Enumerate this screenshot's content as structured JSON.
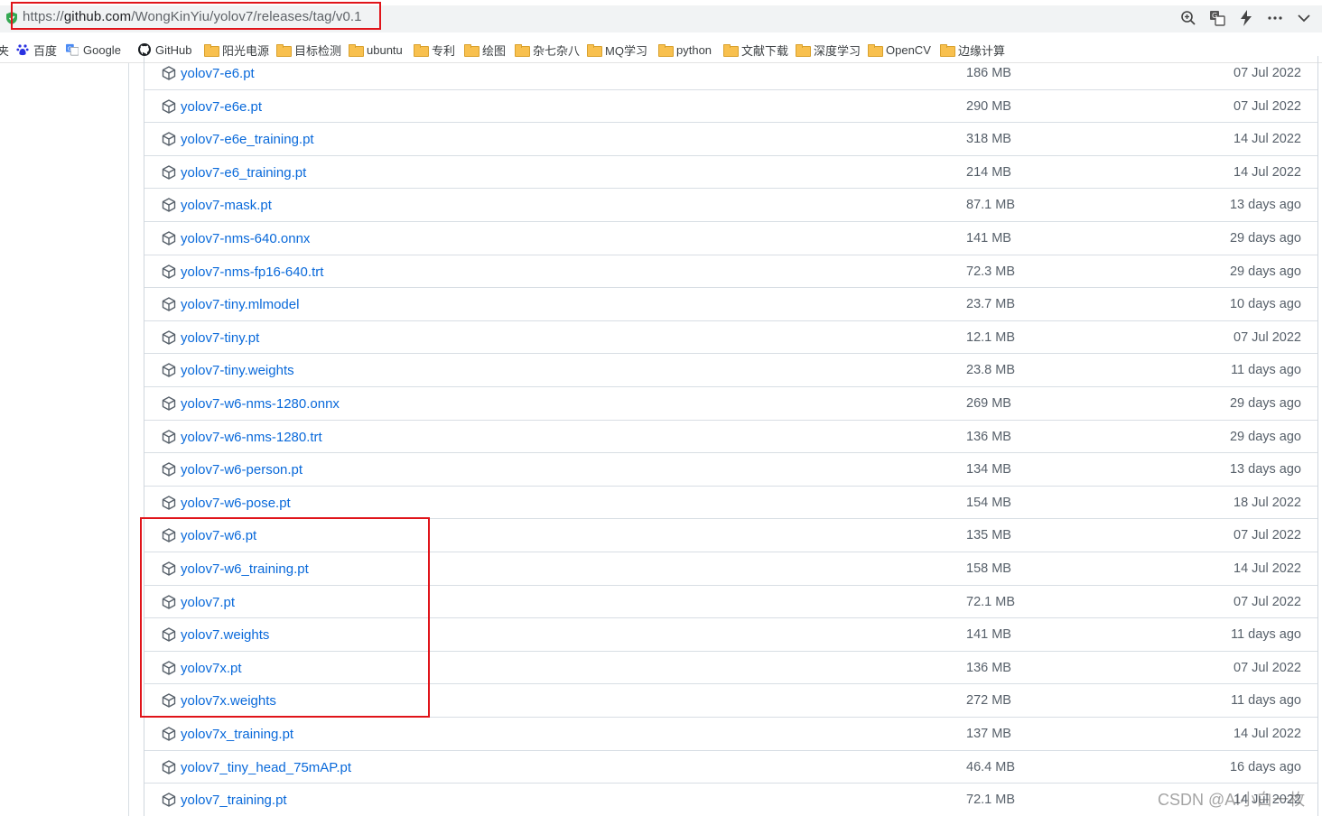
{
  "address_bar": {
    "url_scheme": "https://",
    "url_host": "github.com",
    "url_path": "/WongKinYiu/yolov7/releases/tag/v0.1",
    "actions": [
      "zoom-icon",
      "translate-icon",
      "lightning-icon",
      "more-icon",
      "chevron-down-icon"
    ]
  },
  "bookmarks": [
    {
      "label": "夹",
      "icon": "bookmark-folder-icon"
    },
    {
      "label": "百度",
      "icon": "baidu-icon"
    },
    {
      "label": "Google",
      "icon": "google-icon"
    },
    {
      "label": "GitHub",
      "icon": "github-icon"
    },
    {
      "label": "阳光电源",
      "icon": "folder-icon"
    },
    {
      "label": "目标检测",
      "icon": "folder-icon"
    },
    {
      "label": "ubuntu",
      "icon": "folder-icon"
    },
    {
      "label": "专利",
      "icon": "folder-icon"
    },
    {
      "label": "绘图",
      "icon": "folder-icon"
    },
    {
      "label": "杂七杂八",
      "icon": "folder-icon"
    },
    {
      "label": "MQ学习",
      "icon": "folder-icon"
    },
    {
      "label": "python",
      "icon": "folder-icon"
    },
    {
      "label": "文献下载",
      "icon": "folder-icon"
    },
    {
      "label": "深度学习",
      "icon": "folder-icon"
    },
    {
      "label": "OpenCV",
      "icon": "folder-icon"
    },
    {
      "label": "边缘计算",
      "icon": "folder-icon"
    }
  ],
  "assets": [
    {
      "name": "yolov7-e6.pt",
      "size": "186 MB",
      "date": "07 Jul 2022"
    },
    {
      "name": "yolov7-e6e.pt",
      "size": "290 MB",
      "date": "07 Jul 2022"
    },
    {
      "name": "yolov7-e6e_training.pt",
      "size": "318 MB",
      "date": "14 Jul 2022"
    },
    {
      "name": "yolov7-e6_training.pt",
      "size": "214 MB",
      "date": "14 Jul 2022"
    },
    {
      "name": "yolov7-mask.pt",
      "size": "87.1 MB",
      "date": "13 days ago"
    },
    {
      "name": "yolov7-nms-640.onnx",
      "size": "141 MB",
      "date": "29 days ago"
    },
    {
      "name": "yolov7-nms-fp16-640.trt",
      "size": "72.3 MB",
      "date": "29 days ago"
    },
    {
      "name": "yolov7-tiny.mlmodel",
      "size": "23.7 MB",
      "date": "10 days ago"
    },
    {
      "name": "yolov7-tiny.pt",
      "size": "12.1 MB",
      "date": "07 Jul 2022"
    },
    {
      "name": "yolov7-tiny.weights",
      "size": "23.8 MB",
      "date": "11 days ago"
    },
    {
      "name": "yolov7-w6-nms-1280.onnx",
      "size": "269 MB",
      "date": "29 days ago"
    },
    {
      "name": "yolov7-w6-nms-1280.trt",
      "size": "136 MB",
      "date": "29 days ago"
    },
    {
      "name": "yolov7-w6-person.pt",
      "size": "134 MB",
      "date": "13 days ago"
    },
    {
      "name": "yolov7-w6-pose.pt",
      "size": "154 MB",
      "date": "18 Jul 2022"
    },
    {
      "name": "yolov7-w6.pt",
      "size": "135 MB",
      "date": "07 Jul 2022"
    },
    {
      "name": "yolov7-w6_training.pt",
      "size": "158 MB",
      "date": "14 Jul 2022"
    },
    {
      "name": "yolov7.pt",
      "size": "72.1 MB",
      "date": "07 Jul 2022"
    },
    {
      "name": "yolov7.weights",
      "size": "141 MB",
      "date": "11 days ago"
    },
    {
      "name": "yolov7x.pt",
      "size": "136 MB",
      "date": "07 Jul 2022"
    },
    {
      "name": "yolov7x.weights",
      "size": "272 MB",
      "date": "11 days ago"
    },
    {
      "name": "yolov7x_training.pt",
      "size": "137 MB",
      "date": "14 Jul 2022"
    },
    {
      "name": "yolov7_tiny_head_75mAP.pt",
      "size": "46.4 MB",
      "date": "16 days ago"
    },
    {
      "name": "yolov7_training.pt",
      "size": "72.1 MB",
      "date": "14 Jul 2022"
    }
  ],
  "watermark": "CSDN @AI小白一枚",
  "colors": {
    "link": "#0969da",
    "muted": "#57606a",
    "highlight": "#e0141a"
  }
}
